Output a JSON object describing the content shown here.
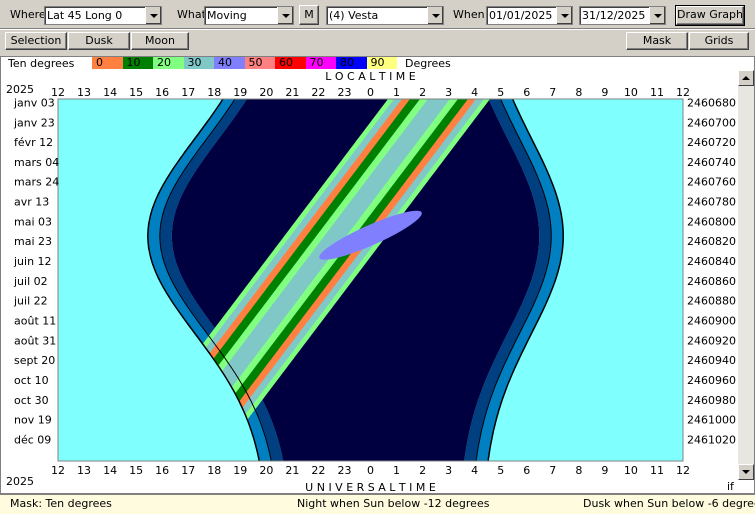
{
  "toolbar": {
    "where_label": "Where",
    "where_value": "Lat 45 Long 0",
    "what_label": "What",
    "what_value": "Moving",
    "m_button": "M",
    "object_value": "(4) Vesta",
    "when_label": "When",
    "date_from": "01/01/2025",
    "date_to": "31/12/2025",
    "draw_button": "Draw Graph"
  },
  "toolbar2": {
    "selection": "Selection",
    "dusk": "Dusk",
    "moon": "Moon",
    "mask": "Mask",
    "grids": "Grids"
  },
  "legend": {
    "title": "Ten degrees",
    "unit": "Degrees",
    "ticks": [
      "0",
      "10",
      "20",
      "30",
      "40",
      "50",
      "60",
      "70",
      "80",
      "90"
    ],
    "colors": [
      "#ff8040",
      "#008000",
      "#80ff80",
      "#80c8c8",
      "#8080ff",
      "#ff8080",
      "#ff0000",
      "#ff00ff",
      "#0000ff",
      "#ffff80"
    ]
  },
  "graph": {
    "year_top": "2025",
    "year_bottom": "2025",
    "top_axis_title": "L O C A L     T I M E",
    "bottom_axis_title": "U N I V E R S A L     T I M E",
    "hour_labels": [
      "12",
      "13",
      "14",
      "15",
      "16",
      "17",
      "18",
      "19",
      "20",
      "21",
      "22",
      "23",
      "0",
      "1",
      "2",
      "3",
      "4",
      "5",
      "6",
      "7",
      "8",
      "9",
      "10",
      "11",
      "12"
    ],
    "date_labels": [
      "janv 03",
      "janv 23",
      "févr 12",
      "mars 04",
      "mars 24",
      "avr 13",
      "mai 03",
      "mai 23",
      "juin 12",
      "juil 02",
      "juil 22",
      "août 11",
      "août 31",
      "sept 20",
      "oct 10",
      "oct 30",
      "nov 19",
      "déc 09"
    ],
    "jd_labels": [
      "2460680",
      "2460700",
      "2460720",
      "2460740",
      "2460760",
      "2460780",
      "2460800",
      "2460820",
      "2460840",
      "2460860",
      "2460880",
      "2460900",
      "2460920",
      "2460940",
      "2460960",
      "2460980",
      "2461000",
      "2461020"
    ],
    "corner_label": "if",
    "colors": {
      "day": "#80ffff",
      "night": "#000040",
      "twilight_light": "#0080c0",
      "twilight_dark": "#004080"
    }
  },
  "status": {
    "mask": "Mask:  Ten degrees",
    "night": "Night when Sun below -12 degrees",
    "dusk": "Dusk when Sun below -6 degrees"
  }
}
